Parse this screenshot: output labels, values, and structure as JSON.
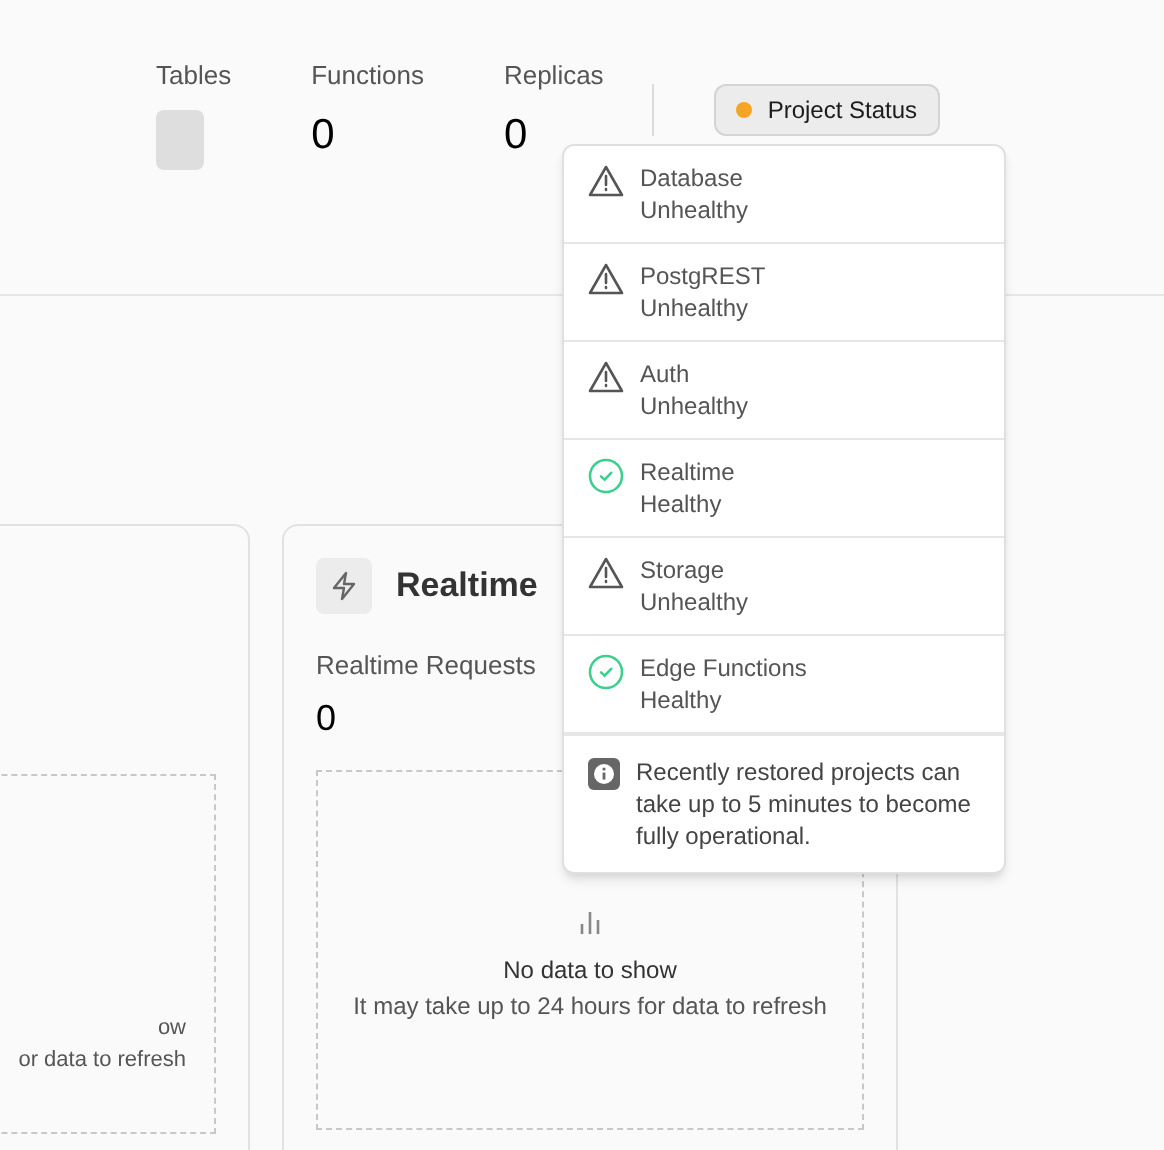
{
  "stats": [
    {
      "label": "Tables",
      "loading": true
    },
    {
      "label": "Functions",
      "value": "0",
      "loading": false
    },
    {
      "label": "Replicas",
      "value": "0",
      "loading": false
    }
  ],
  "status_button": {
    "label": "Project Status",
    "color": "#f5a524"
  },
  "status_popover": {
    "services": [
      {
        "name": "Database",
        "status": "Unhealthy",
        "healthy": false
      },
      {
        "name": "PostgREST",
        "status": "Unhealthy",
        "healthy": false
      },
      {
        "name": "Auth",
        "status": "Unhealthy",
        "healthy": false
      },
      {
        "name": "Realtime",
        "status": "Healthy",
        "healthy": true
      },
      {
        "name": "Storage",
        "status": "Unhealthy",
        "healthy": false
      },
      {
        "name": "Edge Functions",
        "status": "Healthy",
        "healthy": true
      }
    ],
    "note": "Recently restored projects can take up to 5 minutes to become fully operational."
  },
  "left_card": {
    "empty_title": "ow",
    "empty_text": "or data to refresh"
  },
  "realtime_card": {
    "title": "Realtime",
    "metric_label": "Realtime Requests",
    "metric_value": "0",
    "empty_title": "No data to show",
    "empty_text": "It may take up to 24 hours for data to refresh"
  }
}
